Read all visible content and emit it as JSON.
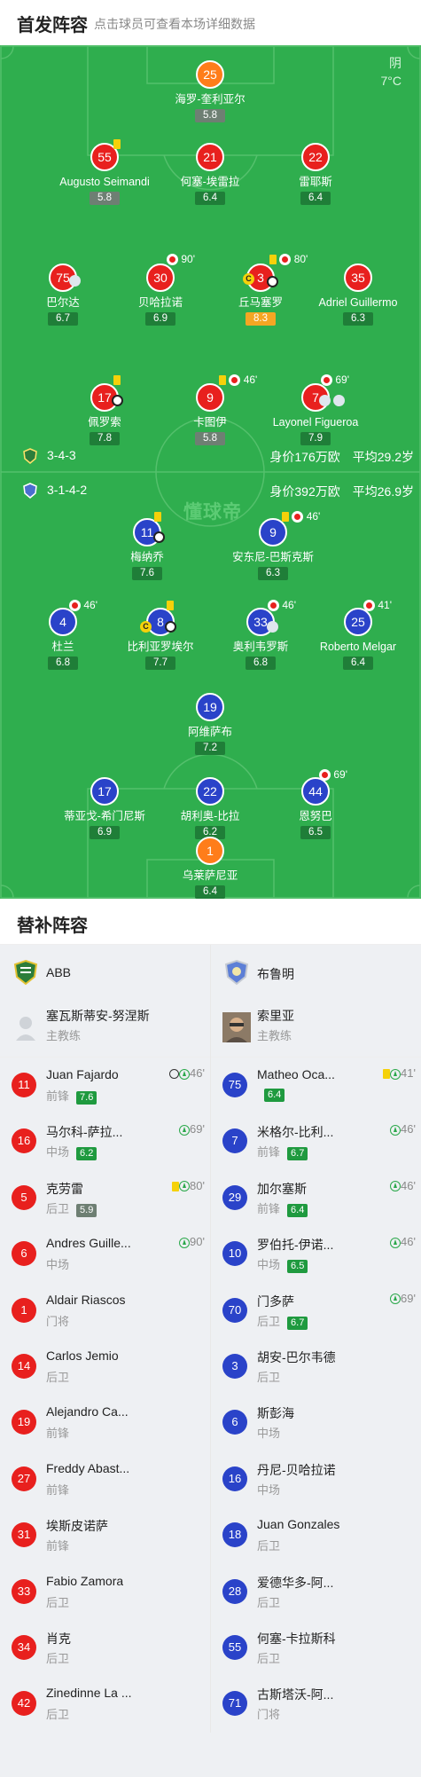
{
  "header": {
    "title": "首发阵容",
    "subtitle": "点击球员可查看本场详细数据"
  },
  "weather": {
    "cond": "阴",
    "temp": "7°C"
  },
  "watermark": "懂球帝",
  "home": {
    "formation": "3-4-3",
    "value_label": "身价176万欧",
    "age_label": "平均29.2岁"
  },
  "away": {
    "formation": "3-1-4-2",
    "value_label": "身价392万欧",
    "age_label": "平均26.9岁"
  },
  "pitch_players": [
    {
      "num": "25",
      "name": "海罗-奎利亚尔",
      "rating": "5.8",
      "color": "orange",
      "rate_style": "grey"
    },
    {
      "num": "55",
      "name": "Augusto Seimandi",
      "rating": "5.8",
      "color": "red",
      "rate_style": "grey"
    },
    {
      "num": "21",
      "name": "何塞-埃雷拉",
      "rating": "6.4",
      "color": "red",
      "rate_style": "green"
    },
    {
      "num": "22",
      "name": "雷耶斯",
      "rating": "6.4",
      "color": "red",
      "rate_style": "green"
    },
    {
      "num": "75",
      "name": "巴尔达",
      "rating": "6.7",
      "color": "red",
      "rate_style": "green"
    },
    {
      "num": "30",
      "name": "贝哈拉诺",
      "rating": "6.9",
      "color": "red",
      "rate_style": "green"
    },
    {
      "num": "3",
      "name": "丘马塞罗",
      "rating": "8.3",
      "color": "red",
      "rate_style": "orange"
    },
    {
      "num": "35",
      "name": "Adriel Guillermo",
      "rating": "6.3",
      "color": "red",
      "rate_style": "green"
    },
    {
      "num": "17",
      "name": "佩罗索",
      "rating": "7.8",
      "color": "red",
      "rate_style": "green"
    },
    {
      "num": "9",
      "name": "卡图伊",
      "rating": "5.8",
      "color": "red",
      "rate_style": "grey"
    },
    {
      "num": "7",
      "name": "Layonel Figueroa",
      "rating": "7.9",
      "color": "red",
      "rate_style": "green"
    },
    {
      "num": "11",
      "name": "梅纳乔",
      "rating": "7.6",
      "color": "blue",
      "rate_style": "green"
    },
    {
      "num": "9",
      "name": "安东尼-巴斯克斯",
      "rating": "6.3",
      "color": "blue",
      "rate_style": "green"
    },
    {
      "num": "4",
      "name": "杜兰",
      "rating": "6.8",
      "color": "blue",
      "rate_style": "green"
    },
    {
      "num": "8",
      "name": "比利亚罗埃尔",
      "rating": "7.7",
      "color": "blue",
      "rate_style": "green"
    },
    {
      "num": "33",
      "name": "奥利韦罗斯",
      "rating": "6.8",
      "color": "blue",
      "rate_style": "green"
    },
    {
      "num": "25",
      "name": "Roberto Melgar",
      "rating": "6.4",
      "color": "blue",
      "rate_style": "green"
    },
    {
      "num": "19",
      "name": "阿维萨布",
      "rating": "7.2",
      "color": "blue",
      "rate_style": "green"
    },
    {
      "num": "17",
      "name": "蒂亚戈-希门尼斯",
      "rating": "6.9",
      "color": "blue",
      "rate_style": "green"
    },
    {
      "num": "22",
      "name": "胡利奥-比拉",
      "rating": "6.2",
      "color": "blue",
      "rate_style": "green"
    },
    {
      "num": "44",
      "name": "恩努巴",
      "rating": "6.5",
      "color": "blue",
      "rate_style": "green"
    },
    {
      "num": "1",
      "name": "乌莱萨尼亚",
      "rating": "6.4",
      "color": "orange",
      "rate_style": "green"
    }
  ],
  "pitch_events": {
    "e30": "90'",
    "e3": "80'",
    "e9h": "46'",
    "e7h": "69'",
    "e9a": "46'",
    "e4": "46'",
    "e33": "46'",
    "e25": "41'",
    "e44": "69'",
    "cap": "C"
  },
  "subs": {
    "title": "替补阵容",
    "home": {
      "team": "ABB",
      "coach": {
        "name": "塞瓦斯蒂安-努涅斯",
        "role": "主教练"
      },
      "players": [
        {
          "num": "11",
          "name": "Juan Fajardo",
          "pos": "前锋",
          "rating": "7.6",
          "rs": "green",
          "event": "46'"
        },
        {
          "num": "16",
          "name": "马尔科-萨拉...",
          "pos": "中场",
          "rating": "6.2",
          "rs": "green",
          "event": "69'"
        },
        {
          "num": "5",
          "name": "克劳雷",
          "pos": "后卫",
          "rating": "5.9",
          "rs": "grey",
          "event": "80'"
        },
        {
          "num": "6",
          "name": "Andres Guille...",
          "pos": "中场",
          "rating": "",
          "rs": "",
          "event": "90'"
        },
        {
          "num": "1",
          "name": "Aldair Riascos",
          "pos": "门将",
          "rating": "",
          "rs": "",
          "event": ""
        },
        {
          "num": "14",
          "name": "Carlos Jemio",
          "pos": "后卫",
          "rating": "",
          "rs": "",
          "event": ""
        },
        {
          "num": "19",
          "name": "Alejandro Ca...",
          "pos": "前锋",
          "rating": "",
          "rs": "",
          "event": ""
        },
        {
          "num": "27",
          "name": "Freddy Abast...",
          "pos": "前锋",
          "rating": "",
          "rs": "",
          "event": ""
        },
        {
          "num": "31",
          "name": "埃斯皮诺萨",
          "pos": "前锋",
          "rating": "",
          "rs": "",
          "event": ""
        },
        {
          "num": "33",
          "name": "Fabio Zamora",
          "pos": "后卫",
          "rating": "",
          "rs": "",
          "event": ""
        },
        {
          "num": "34",
          "name": "肖克",
          "pos": "后卫",
          "rating": "",
          "rs": "",
          "event": ""
        },
        {
          "num": "42",
          "name": "Zinedinne La ...",
          "pos": "后卫",
          "rating": "",
          "rs": "",
          "event": ""
        }
      ]
    },
    "away": {
      "team": "布鲁明",
      "coach": {
        "name": "索里亚",
        "role": "主教练"
      },
      "players": [
        {
          "num": "75",
          "name": "Matheo Oca...",
          "pos": "",
          "rating": "6.4",
          "rs": "green",
          "event": "41'"
        },
        {
          "num": "7",
          "name": "米格尔-比利...",
          "pos": "前锋",
          "rating": "6.7",
          "rs": "green",
          "event": "46'"
        },
        {
          "num": "29",
          "name": "加尔塞斯",
          "pos": "前锋",
          "rating": "6.4",
          "rs": "green",
          "event": "46'"
        },
        {
          "num": "10",
          "name": "罗伯托-伊诺...",
          "pos": "中场",
          "rating": "6.5",
          "rs": "green",
          "event": "46'"
        },
        {
          "num": "70",
          "name": "门多萨",
          "pos": "后卫",
          "rating": "6.7",
          "rs": "green",
          "event": "69'"
        },
        {
          "num": "3",
          "name": "胡安-巴尔韦德",
          "pos": "后卫",
          "rating": "",
          "rs": "",
          "event": ""
        },
        {
          "num": "6",
          "name": "斯彭海",
          "pos": "中场",
          "rating": "",
          "rs": "",
          "event": ""
        },
        {
          "num": "16",
          "name": "丹尼-贝哈拉诺",
          "pos": "中场",
          "rating": "",
          "rs": "",
          "event": ""
        },
        {
          "num": "18",
          "name": "Juan Gonzales",
          "pos": "后卫",
          "rating": "",
          "rs": "",
          "event": ""
        },
        {
          "num": "28",
          "name": "爱德华多-阿...",
          "pos": "后卫",
          "rating": "",
          "rs": "",
          "event": ""
        },
        {
          "num": "55",
          "name": "何塞-卡拉斯科",
          "pos": "后卫",
          "rating": "",
          "rs": "",
          "event": ""
        },
        {
          "num": "71",
          "name": "古斯塔沃-阿...",
          "pos": "门将",
          "rating": "",
          "rs": "",
          "event": ""
        }
      ]
    }
  }
}
